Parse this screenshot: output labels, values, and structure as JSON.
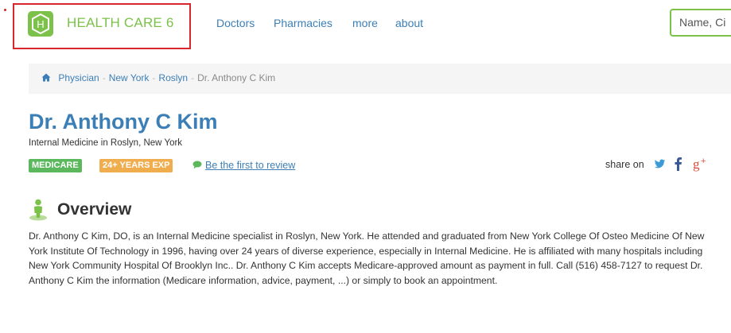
{
  "header": {
    "logo_text": "HEALTH CARE 6",
    "logo_letter": "H",
    "nav": [
      "Doctors",
      "Pharmacies",
      "more",
      "about"
    ],
    "search_value": "Name, Ci"
  },
  "breadcrumb": {
    "items": [
      "Physician",
      "New York",
      "Roslyn"
    ],
    "current": "Dr. Anthony C Kim"
  },
  "profile": {
    "name": "Dr. Anthony C Kim",
    "specialty": "Internal Medicine in Roslyn, New York",
    "badges": [
      "MEDICARE",
      "24+ YEARS EXP"
    ],
    "review_link": "Be the first to review",
    "share_label": "share on",
    "share_icons": [
      "twitter-icon",
      "facebook-icon",
      "google-plus-icon"
    ]
  },
  "overview": {
    "heading": "Overview",
    "text": "Dr. Anthony C Kim, DO, is an Internal Medicine specialist in Roslyn, New York. He attended and graduated from New York College Of Osteo Medicine Of New York Institute Of Technology in 1996, having over 24 years of diverse experience, especially in Internal Medicine. He is affiliated with many hospitals including New York Community Hospital Of Brooklyn Inc.. Dr. Anthony C Kim accepts Medicare-approved amount as payment in full. Call (516) 458-7127 to request Dr. Anthony C Kim the information (Medicare information, advice, payment, ...) or simply to book an appointment."
  },
  "colors": {
    "brand_green": "#7bc14a",
    "link_blue": "#3c7fb6",
    "badge_green": "#5cb85c",
    "badge_orange": "#f0ad4e",
    "highlight_red": "#d9262c"
  }
}
